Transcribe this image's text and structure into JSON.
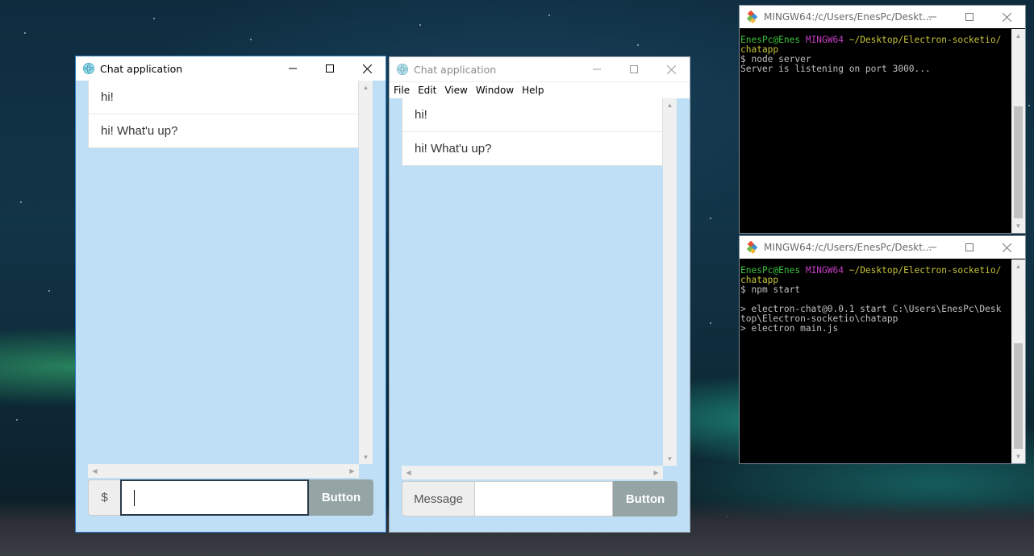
{
  "window1": {
    "title": "Chat application",
    "messages": [
      "hi!",
      "hi! What'u up?"
    ],
    "input_addon": "$",
    "input_value": "",
    "button_label": "Button"
  },
  "window2": {
    "title": "Chat application",
    "menu": [
      "File",
      "Edit",
      "View",
      "Window",
      "Help"
    ],
    "messages": [
      "hi!",
      "hi! What'u up?"
    ],
    "input_addon": "Message",
    "input_value": "",
    "button_label": "Button"
  },
  "terminal1": {
    "title": "MINGW64:/c/Users/EnesPc/Deskt...",
    "lines": [
      [
        {
          "t": "EnesPc@Enes ",
          "c": "g"
        },
        {
          "t": "MINGW64 ",
          "c": "m"
        },
        {
          "t": "~/Desktop/Electron-socketio/",
          "c": "y"
        }
      ],
      [
        {
          "t": "chatapp",
          "c": "y"
        }
      ],
      [
        {
          "t": "$ node server",
          "c": "w"
        }
      ],
      [
        {
          "t": "Server is listening on port 3000...",
          "c": "w"
        }
      ]
    ]
  },
  "terminal2": {
    "title": "MINGW64:/c/Users/EnesPc/Deskt...",
    "lines": [
      [
        {
          "t": "EnesPc@Enes ",
          "c": "g"
        },
        {
          "t": "MINGW64 ",
          "c": "m"
        },
        {
          "t": "~/Desktop/Electron-socketio/",
          "c": "y"
        }
      ],
      [
        {
          "t": "chatapp",
          "c": "y"
        }
      ],
      [
        {
          "t": "$ npm start",
          "c": "w"
        }
      ],
      [
        {
          "t": "",
          "c": "w"
        }
      ],
      [
        {
          "t": "> electron-chat@0.0.1 start C:\\Users\\EnesPc\\Desk",
          "c": "w"
        }
      ],
      [
        {
          "t": "top\\Electron-socketio\\chatapp",
          "c": "w"
        }
      ],
      [
        {
          "t": "> electron main.js",
          "c": "w"
        }
      ]
    ]
  }
}
